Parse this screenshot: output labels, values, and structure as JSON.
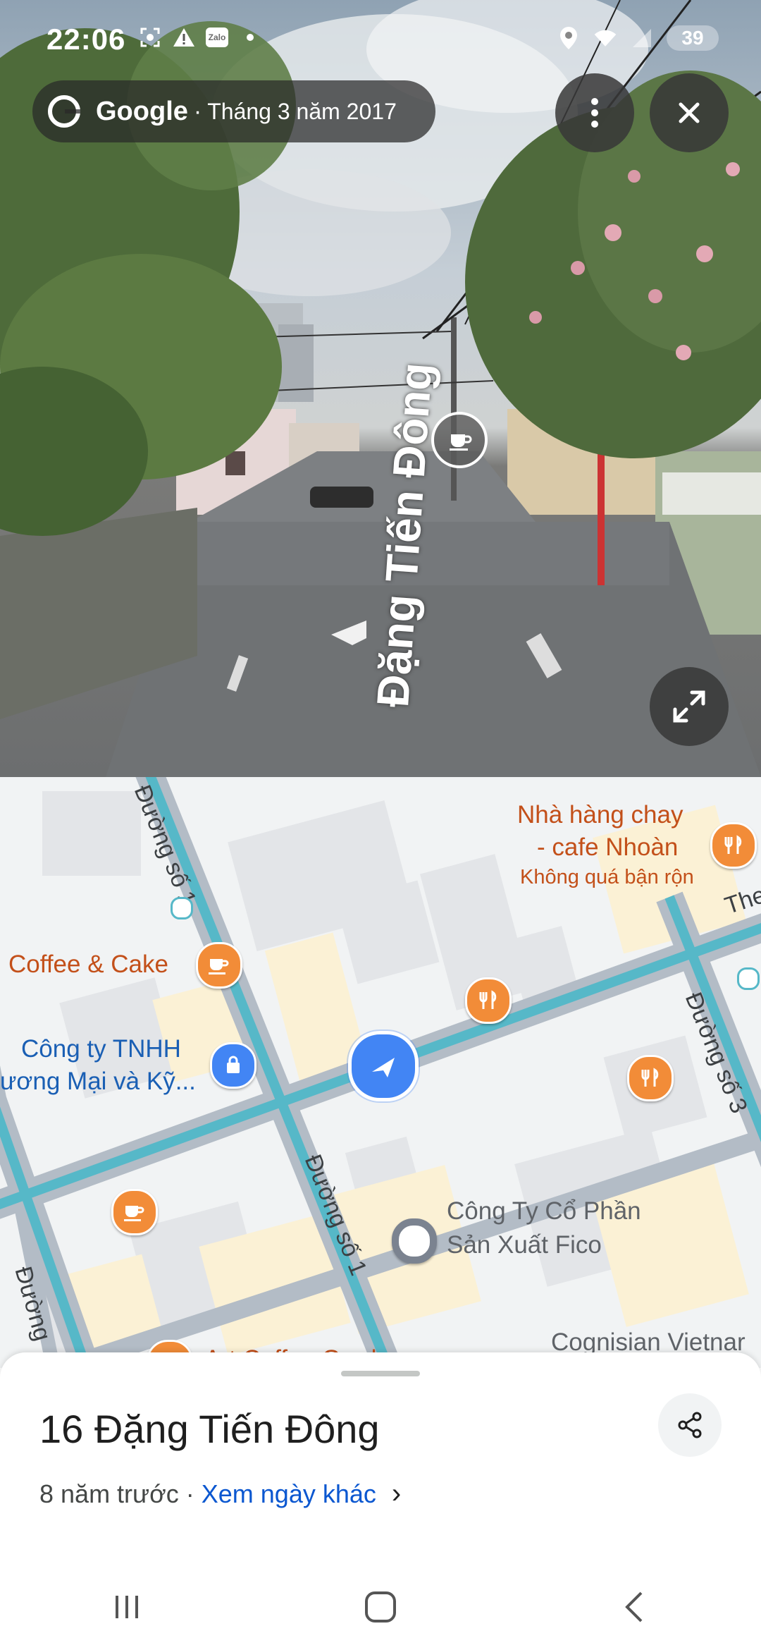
{
  "status_bar": {
    "time": "22:06",
    "zalo": "Zalo",
    "battery": "39"
  },
  "streetview": {
    "brand": "Google",
    "separator": "·",
    "capture_date": "Tháng 3 năm 2017",
    "street_name": "Đặng Tiến Đông",
    "icons": [
      "more-vert-icon",
      "close-icon",
      "fullscreen-icon",
      "cafe-icon"
    ]
  },
  "map": {
    "places": [
      {
        "name": "Nhà hàng chay",
        "name2": "- cafe Nhoàn",
        "status": "Không quá bận rộn"
      },
      {
        "name": "Coffee & Cake"
      },
      {
        "name": "Công ty TNHH",
        "name2": "ương Mại và Kỹ..."
      },
      {
        "name": "Công Ty Cổ Phần",
        "name2": "Sản Xuất Fico"
      },
      {
        "name": "Cognisian Vietnar"
      },
      {
        "name": "Art Coffee Garden"
      }
    ],
    "roads": {
      "road1_top": "Đường số 1",
      "road1_bottom": "Đường số 1",
      "road3": "Đường số 3",
      "road_left": "Đường",
      "road_top_right": "The"
    }
  },
  "sheet": {
    "address": "16 Đặng Tiến Đông",
    "age": "8 năm trước",
    "dot": "·",
    "other_dates": "Xem ngày khác",
    "chevron": "›"
  },
  "colors": {
    "road_teal": "#56b8c8",
    "road_border": "#9aa6b2",
    "building": "#e8eaed",
    "building_yellow": "#fbf1d5",
    "poi_orange": "#f28c38",
    "link_blue": "#0b57d0"
  }
}
